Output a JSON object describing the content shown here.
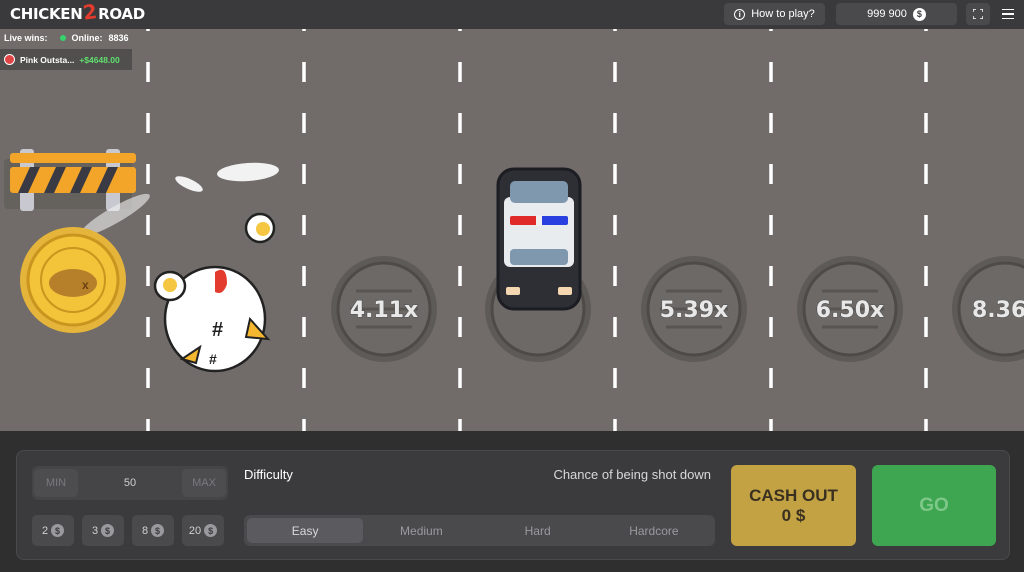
{
  "header": {
    "logo_part1": "CHICKEN",
    "logo_part2": "2",
    "logo_part3": "ROAD",
    "how_to_play": "How to play?",
    "balance": "999 900",
    "currency_symbol": "$"
  },
  "live": {
    "live_wins_label": "Live wins:",
    "online_label": "Online:",
    "online_count": "8836",
    "win_user": "Pink Outsta...",
    "win_amount": "+$4648.00"
  },
  "road": {
    "multipliers": [
      "4.11x",
      "5.39x",
      "6.50x",
      "8.36"
    ],
    "colors": {
      "road": "#716c6a",
      "lane_marking": "#ffffff",
      "coin": "#f3c43a"
    }
  },
  "controls": {
    "min_label": "MIN",
    "bet_value": "50",
    "max_label": "MAX",
    "chips": [
      {
        "value": "2",
        "symbol": "$"
      },
      {
        "value": "3",
        "symbol": "$"
      },
      {
        "value": "8",
        "symbol": "$"
      },
      {
        "value": "20",
        "symbol": "$"
      }
    ],
    "difficulty_label": "Difficulty",
    "chance_label": "Chance of being shot down",
    "difficulties": [
      "Easy",
      "Medium",
      "Hard",
      "Hardcore"
    ],
    "selected_difficulty": "Easy",
    "cashout_label": "CASH OUT",
    "cashout_amount": "0 $",
    "go_label": "GO",
    "colors": {
      "cashout": "#c3a244",
      "go": "#3ea551"
    }
  }
}
